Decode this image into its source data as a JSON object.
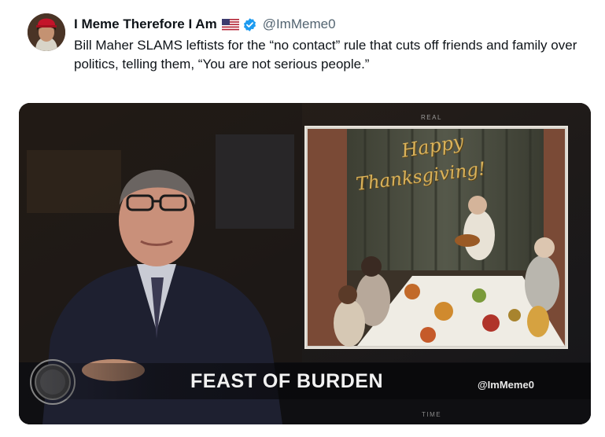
{
  "tweet": {
    "display_name": "I Meme Therefore I Am",
    "handle": "@ImMeme0",
    "text": "Bill Maher SLAMS leftists for the “no contact” rule that cuts off friends and family over politics, telling them, “You are not serious people.”"
  },
  "media": {
    "caption": "FEAST OF BURDEN",
    "watermark": "@ImMeme0",
    "card_line1": "Happy",
    "card_line2": "Thanksgiving!",
    "screen_label_top": "REAL",
    "screen_label_bottom": "TIME"
  },
  "icons": {
    "flag": "us-flag-icon",
    "verified": "verified-badge-icon",
    "play": "video-play-icon"
  },
  "colors": {
    "verified_blue": "#1d9bf0",
    "handle_gray": "#536471",
    "text": "#0f1419"
  }
}
